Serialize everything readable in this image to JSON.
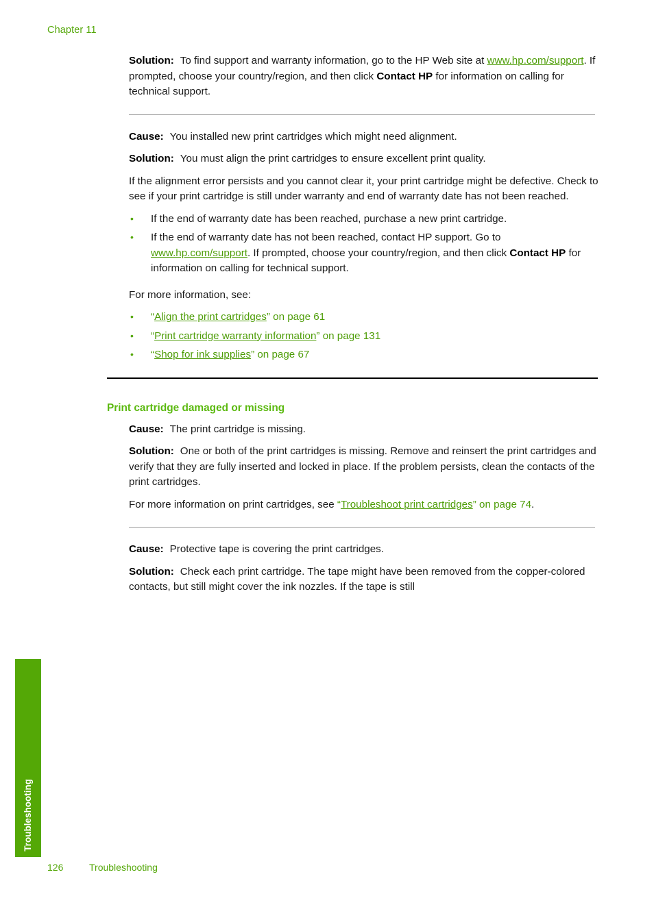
{
  "page": {
    "chapter_header": "Chapter 11",
    "side_tab_label": "Troubleshooting",
    "footer": {
      "page_number": "126",
      "section_name": "Troubleshooting"
    },
    "colors": {
      "accent_green": "#55a80a",
      "heading_green": "#5bb90f",
      "link_green": "#4e9d08",
      "side_tab_green": "#54a806",
      "body_black": "#1a1a1a",
      "thin_rule_gray": "#9a9a9a"
    }
  },
  "blocks": {
    "solution_1": {
      "label": "Solution:",
      "text_a": "To find support and warranty information, go to the HP Web site at ",
      "link": "www.hp.com/support",
      "text_b": ". If prompted, choose your country/region, and then click ",
      "bold": "Contact HP",
      "text_c": " for information on calling for technical support."
    },
    "cause_1": {
      "label": "Cause:",
      "text": "You installed new print cartridges which might need alignment."
    },
    "solution_2": {
      "label": "Solution:",
      "text": "You must align the print cartridges to ensure excellent print quality."
    },
    "paragraph_1": "If the alignment error persists and you cannot clear it, your print cartridge might be defective. Check to see if your print cartridge is still under warranty and end of warranty date has not been reached.",
    "warranty_bullets": {
      "item_1": "If the end of warranty date has been reached, purchase a new print cartridge.",
      "item_2": {
        "text_a": "If the end of warranty date has not been reached, contact HP support. Go to ",
        "link": "www.hp.com/support",
        "text_b": ". If prompted, choose your country/region, and then click ",
        "bold": "Contact HP",
        "text_c": " for information on calling for technical support."
      }
    },
    "more_info_lead": "For more information, see:",
    "more_info_links": [
      {
        "open_quote": "“",
        "title": "Align the print cartridges",
        "close_quote": "”",
        "page_ref": " on page 61"
      },
      {
        "open_quote": "“",
        "title": "Print cartridge warranty information",
        "close_quote": "”",
        "page_ref": " on page 131"
      },
      {
        "open_quote": "“",
        "title": "Shop for ink supplies",
        "close_quote": "”",
        "page_ref": " on page 67"
      }
    ],
    "section_heading": "Print cartridge damaged or missing",
    "cause_2": {
      "label": "Cause:",
      "text": "The print cartridge is missing."
    },
    "solution_3": {
      "label": "Solution:",
      "text": "One or both of the print cartridges is missing. Remove and reinsert the print cartridges and verify that they are fully inserted and locked in place. If the problem persists, clean the contacts of the print cartridges."
    },
    "more_info_cartridges": {
      "text_a": "For more information on print cartridges, see ",
      "open_quote": "“",
      "link": "Troubleshoot print cartridges",
      "close_quote": "”",
      "page_ref": " on page 74",
      "period": "."
    },
    "cause_3": {
      "label": "Cause:",
      "text": "Protective tape is covering the print cartridges."
    },
    "solution_4": {
      "label": "Solution:",
      "text": "Check each print cartridge. The tape might have been removed from the copper-colored contacts, but still might cover the ink nozzles. If the tape is still"
    }
  }
}
